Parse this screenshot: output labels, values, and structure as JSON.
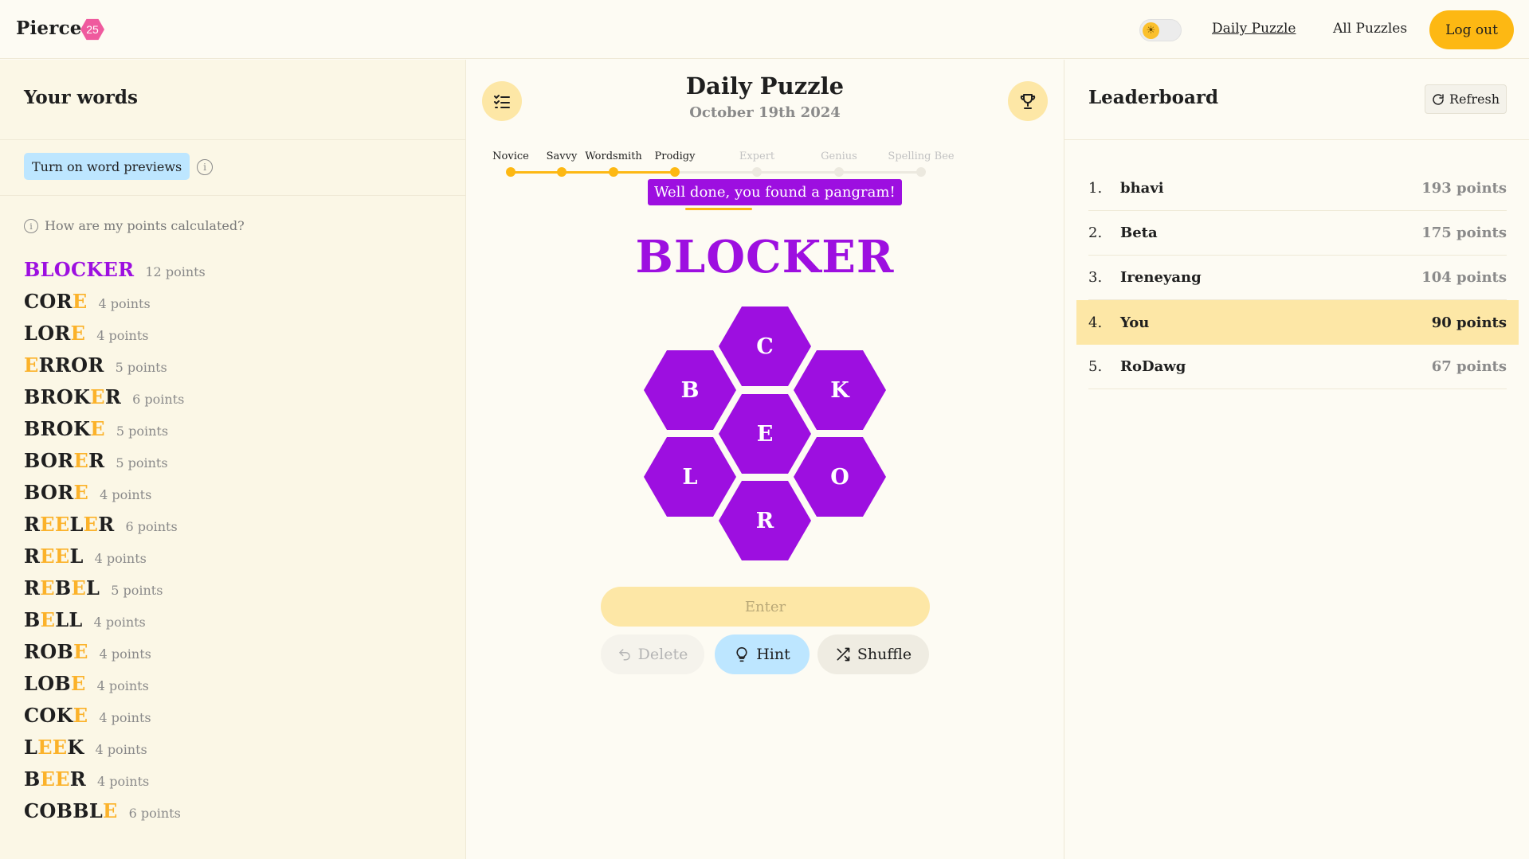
{
  "header": {
    "brand": "Pierce",
    "badge": "25",
    "nav_daily": "Daily Puzzle",
    "nav_all": "All Puzzles",
    "logout": "Log out",
    "theme_icon": "sun-icon"
  },
  "left": {
    "title": "Your words",
    "previews_button": "Turn on word previews",
    "points_help": "How are my points calculated?",
    "words": [
      {
        "word": "BLOCKER",
        "points": "12 points",
        "pangram": true
      },
      {
        "word": "CORE",
        "points": "4 points"
      },
      {
        "word": "LORE",
        "points": "4 points"
      },
      {
        "word": "ERROR",
        "points": "5 points"
      },
      {
        "word": "BROKER",
        "points": "6 points"
      },
      {
        "word": "BROKE",
        "points": "5 points"
      },
      {
        "word": "BORER",
        "points": "5 points"
      },
      {
        "word": "BORE",
        "points": "4 points"
      },
      {
        "word": "REELER",
        "points": "6 points"
      },
      {
        "word": "REEL",
        "points": "4 points"
      },
      {
        "word": "REBEL",
        "points": "5 points"
      },
      {
        "word": "BELL",
        "points": "4 points"
      },
      {
        "word": "ROBE",
        "points": "4 points"
      },
      {
        "word": "LOBE",
        "points": "4 points"
      },
      {
        "word": "COKE",
        "points": "4 points"
      },
      {
        "word": "LEEK",
        "points": "4 points"
      },
      {
        "word": "BEER",
        "points": "4 points"
      },
      {
        "word": "COBBLE",
        "points": "6 points"
      }
    ],
    "center_letter": "E"
  },
  "center": {
    "title": "Daily Puzzle",
    "date": "October 19th 2024",
    "ranks": [
      "Novice",
      "Savvy",
      "Wordsmith",
      "Prodigy",
      "Expert",
      "Genius",
      "Spelling Bee"
    ],
    "current_rank_index": 3,
    "toast": "Well done, you found a pangram!",
    "current_word": "BLOCKER",
    "letters": {
      "top": "C",
      "upper_left": "B",
      "upper_right": "K",
      "center": "E",
      "lower_left": "L",
      "lower_right": "O",
      "bottom": "R"
    },
    "enter": "Enter",
    "delete": "Delete",
    "hint": "Hint",
    "shuffle": "Shuffle",
    "colors": {
      "accent": "#9d0fe0",
      "gold": "#fdb813",
      "center_letter": "#fbb22a"
    }
  },
  "right": {
    "title": "Leaderboard",
    "refresh": "Refresh",
    "entries": [
      {
        "rank": "1.",
        "name": "bhavi",
        "points": "193 points"
      },
      {
        "rank": "2.",
        "name": "Beta",
        "points": "175 points"
      },
      {
        "rank": "3.",
        "name": "Ireneyang",
        "points": "104 points"
      },
      {
        "rank": "4.",
        "name": "You",
        "points": "90 points",
        "me": true
      },
      {
        "rank": "5.",
        "name": "RoDawg",
        "points": "67 points"
      }
    ]
  }
}
